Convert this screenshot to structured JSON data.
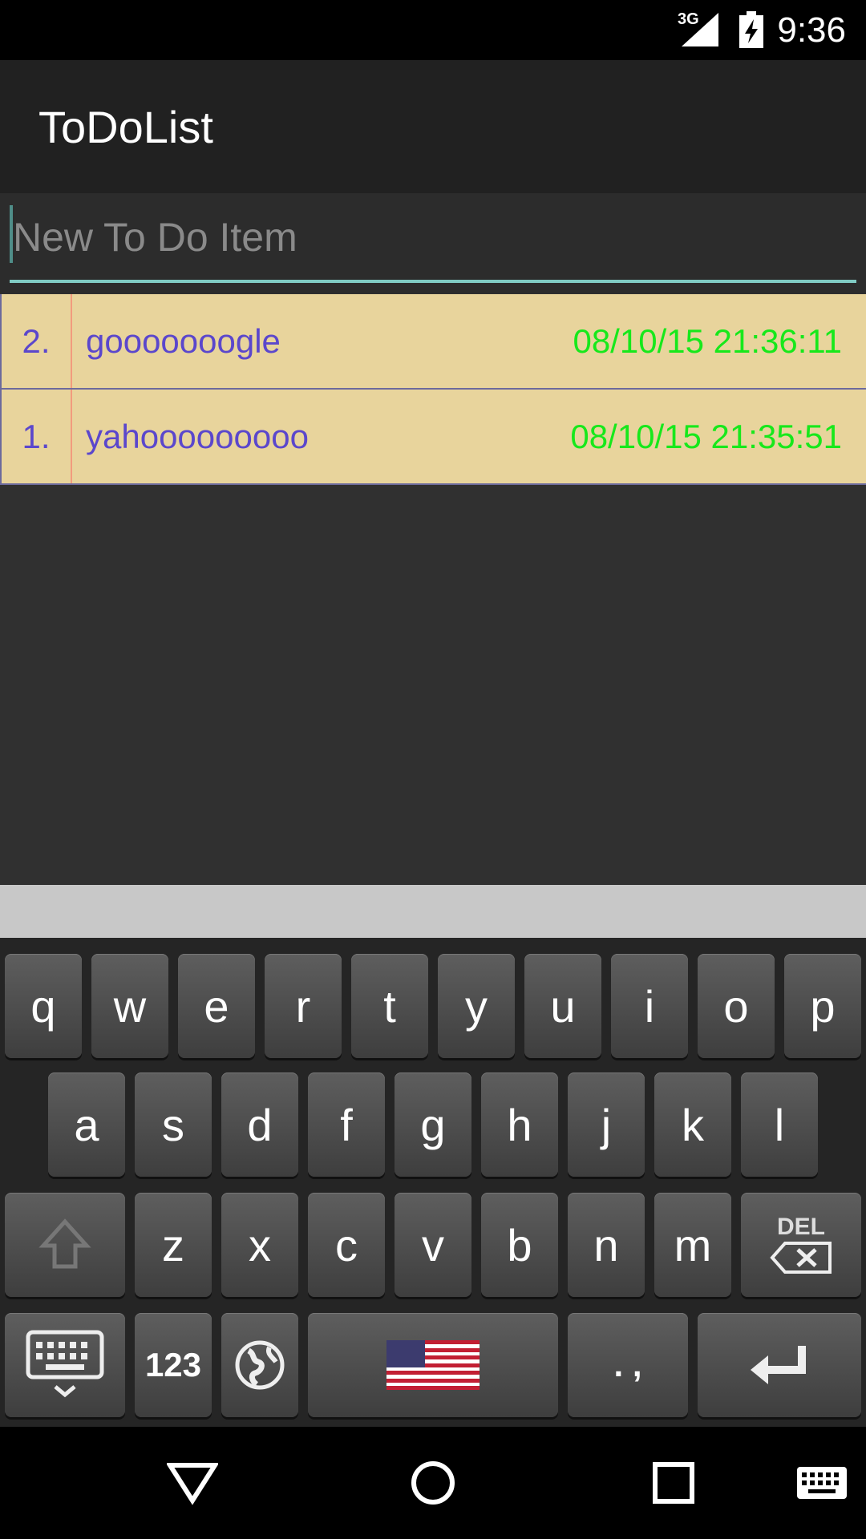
{
  "status_bar": {
    "network": "3G",
    "time": "9:36"
  },
  "action_bar": {
    "title": "ToDoList"
  },
  "new_item": {
    "placeholder": "New To Do Item",
    "value": ""
  },
  "todo_items": [
    {
      "number": "2.",
      "text": "gooooooogle",
      "timestamp": "08/10/15 21:36:11"
    },
    {
      "number": "1.",
      "text": "yahooooooooo",
      "timestamp": "08/10/15 21:35:51"
    }
  ],
  "keyboard": {
    "row1": [
      "q",
      "w",
      "e",
      "r",
      "t",
      "y",
      "u",
      "i",
      "o",
      "p"
    ],
    "row2": [
      "a",
      "s",
      "d",
      "f",
      "g",
      "h",
      "j",
      "k",
      "l"
    ],
    "row3": [
      "z",
      "x",
      "c",
      "v",
      "b",
      "n",
      "m"
    ],
    "delete_label": "DEL",
    "numbers_label": "123",
    "punctuation_label": ". ,"
  },
  "colors": {
    "row_background": "#e8d49c",
    "item_text": "#5b47cc",
    "timestamp_text": "#17e81b",
    "accent": "#80cbc4"
  }
}
